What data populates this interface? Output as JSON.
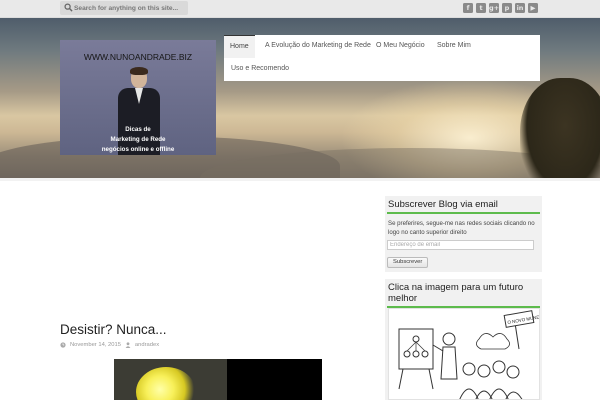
{
  "search": {
    "placeholder": "Search for anything on this site..."
  },
  "social_icons": [
    {
      "name": "facebook-icon",
      "glyph": "f"
    },
    {
      "name": "twitter-icon",
      "glyph": "t"
    },
    {
      "name": "google-plus-icon",
      "glyph": "g+"
    },
    {
      "name": "pinterest-icon",
      "glyph": "p"
    },
    {
      "name": "linkedin-icon",
      "glyph": "in"
    },
    {
      "name": "youtube-icon",
      "glyph": "▶"
    }
  ],
  "logo": {
    "url_text": "WWW.NUNOANDRADE.BIZ",
    "line1": "Dicas de",
    "line2": "Marketing de Rede",
    "line3": "negócios online e offline"
  },
  "nav": {
    "items": [
      {
        "label": "Home",
        "active": true
      },
      {
        "label": "A Evolução do Marketing de Rede"
      },
      {
        "label": "O Meu Negócio"
      },
      {
        "label": "Sobre Mim"
      },
      {
        "label": "Uso e Recomendo"
      }
    ]
  },
  "sidebar": {
    "subscribe": {
      "title": "Subscrever Blog via email",
      "text": "Se preferires, segue-me nas redes sociais clicando no logo no canto superior direito",
      "email_placeholder": "Endereço de email",
      "button": "Subscrever"
    },
    "image_widget": {
      "title": "Clica na imagem para um futuro melhor",
      "sign_text": "O NOVO MUNDO"
    }
  },
  "post": {
    "title": "Desistir? Nunca...",
    "date": "November 14, 2015",
    "author": "andradex"
  },
  "colors": {
    "accent_green": "#5dbb4c",
    "topbar": "#e9e9e9",
    "widget_bg": "#f1f1f1"
  }
}
